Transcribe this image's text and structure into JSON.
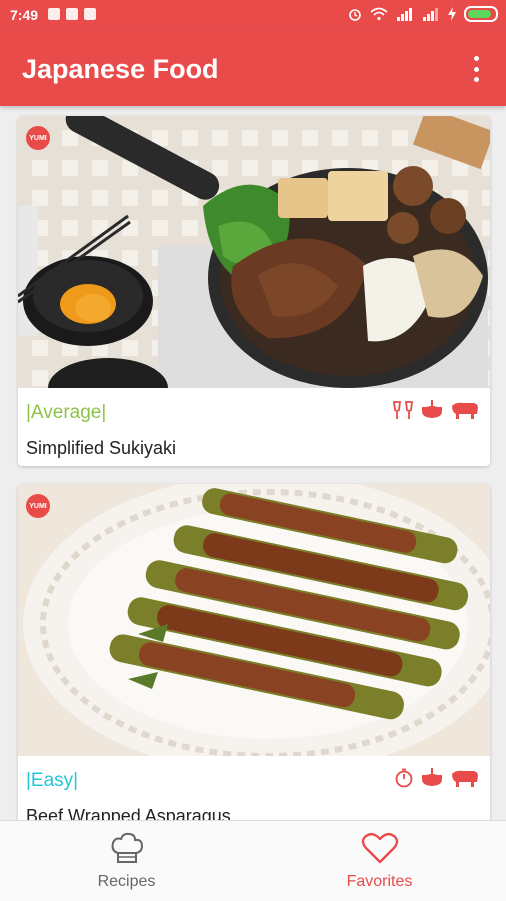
{
  "status_bar": {
    "time": "7:49",
    "battery_level": 0.9,
    "battery_color": "#5bd75b"
  },
  "app_bar": {
    "title": "Japanese Food",
    "background": "#e94b4a",
    "menu_icon": "more-vert-icon"
  },
  "recipes": [
    {
      "badge": "YUMI",
      "difficulty": "|Average|",
      "difficulty_color": "#8bc34a",
      "name": "Simplified Sukiyaki",
      "tag_icons": [
        "cheers-icon",
        "pot-icon",
        "beef-icon"
      ]
    },
    {
      "badge": "YUMI",
      "difficulty": "|Easy|",
      "difficulty_color": "#26c6da",
      "name": "Beef Wrapped Asparagus",
      "tag_icons": [
        "timer-icon",
        "pot-icon",
        "beef-icon"
      ]
    }
  ],
  "bottom_nav": {
    "recipes_label": "Recipes",
    "favorites_label": "Favorites",
    "active": "favorites",
    "active_color": "#e94b4a"
  }
}
